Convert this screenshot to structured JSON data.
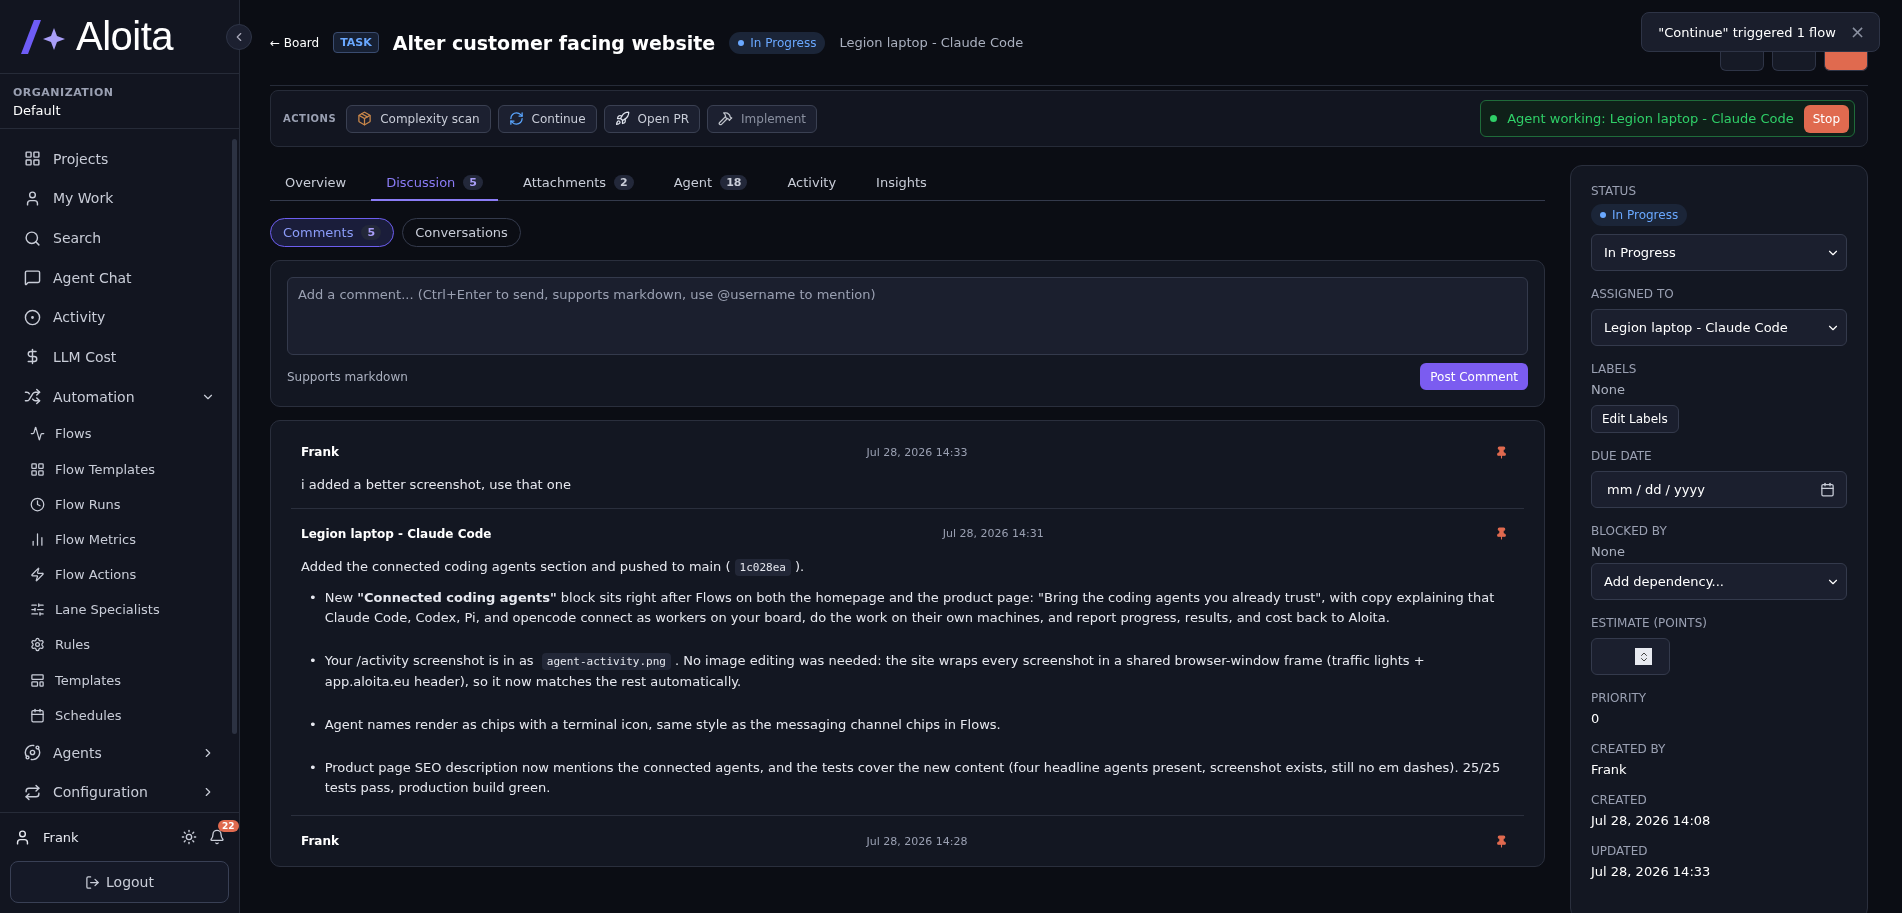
{
  "brand": {
    "name": "Aloita"
  },
  "organization": {
    "label": "ORGANIZATION",
    "name": "Default"
  },
  "sidebar": {
    "items": [
      {
        "label": "Projects",
        "selected": false
      },
      {
        "label": "My Work",
        "selected": false
      },
      {
        "label": "Search",
        "selected": false
      },
      {
        "label": "Agent Chat",
        "selected": false
      },
      {
        "label": "Activity",
        "selected": false
      },
      {
        "label": "LLM Cost",
        "selected": false
      },
      {
        "label": "Automation",
        "selected": false,
        "expanded": true,
        "children": [
          {
            "label": "Flows",
            "selected": false
          },
          {
            "label": "Flow Templates",
            "selected": false
          },
          {
            "label": "Flow Runs",
            "selected": false
          },
          {
            "label": "Flow Metrics",
            "selected": false
          },
          {
            "label": "Flow Actions",
            "selected": false
          },
          {
            "label": "Lane Specialists",
            "selected": false
          },
          {
            "label": "Rules",
            "selected": false
          },
          {
            "label": "Templates",
            "selected": false
          },
          {
            "label": "Schedules",
            "selected": false
          }
        ]
      },
      {
        "label": "Agents",
        "selected": false,
        "expanded": false
      },
      {
        "label": "Configuration",
        "selected": false,
        "expanded": false
      }
    ]
  },
  "user": {
    "name": "Frank",
    "notifications": "22",
    "logout": "Logout"
  },
  "header": {
    "back": "← Board",
    "type": "TASK",
    "title": "Alter customer facing website",
    "status": "In Progress",
    "assignee": "Legion laptop - Claude Code"
  },
  "toast": {
    "text": "\"Continue\" triggered 1 flow",
    "close": "×"
  },
  "actions": {
    "label": "ACTIONS",
    "buttons": [
      {
        "label": "Complexity scan",
        "disabled": false
      },
      {
        "label": "Continue",
        "disabled": false
      },
      {
        "label": "Open PR",
        "disabled": false
      },
      {
        "label": "Implement",
        "disabled": true
      }
    ],
    "agent_status": {
      "text": "Agent working: Legion laptop - Claude Code",
      "stop": "Stop"
    }
  },
  "tabs": [
    {
      "label": "Overview",
      "selected": false
    },
    {
      "label": "Discussion",
      "count": "5",
      "selected": true
    },
    {
      "label": "Attachments",
      "count": "2",
      "selected": false
    },
    {
      "label": "Agent",
      "count": "18",
      "selected": false
    },
    {
      "label": "Activity",
      "selected": false
    },
    {
      "label": "Insights",
      "selected": false
    }
  ],
  "subtabs": [
    {
      "label": "Comments",
      "count": "5",
      "selected": true
    },
    {
      "label": "Conversations",
      "selected": false
    }
  ],
  "composer": {
    "placeholder": "Add a comment... (Ctrl+Enter to send, supports markdown, use @username to mention)",
    "hint": "Supports markdown",
    "submit": "Post Comment"
  },
  "comments": [
    {
      "author": "Frank",
      "time": "Jul 28, 2026 14:33",
      "pinned": true,
      "body": [
        {
          "kind": "paragraph",
          "parts": [
            {
              "kind": "text",
              "text": "i added a better screenshot, use that one"
            }
          ]
        }
      ]
    },
    {
      "author": "Legion laptop - Claude Code",
      "time": "Jul 28, 2026 14:31",
      "pinned": true,
      "body": [
        {
          "kind": "paragraph",
          "parts": [
            {
              "kind": "text",
              "text": "Added the connected coding agents section and pushed to main ("
            },
            {
              "kind": "code",
              "text": "1c028ea"
            },
            {
              "kind": "text",
              "text": ")."
            }
          ]
        },
        {
          "kind": "bullet",
          "marker": "•",
          "parts": [
            {
              "kind": "text",
              "text": "New **\"Connected coding agents\"** block sits right after Flows on both the homepage and the product page: \"Bring the coding agents you already trust\", with copy explaining that Claude Code, Codex, Pi, and opencode connect as workers on your board, do the work on their own machines, and report progress, results, and cost back to Aloita."
            }
          ]
        },
        {
          "kind": "bullet",
          "marker": "•",
          "parts": [
            {
              "kind": "text",
              "text": "Your /activity screenshot is in as "
            },
            {
              "kind": "code",
              "text": "agent-activity.png"
            },
            {
              "kind": "text",
              "text": ". No image editing was needed: the site wraps every screenshot in a shared browser-window frame (traffic lights + app.aloita.eu header), so it now matches the rest automatically."
            }
          ]
        },
        {
          "kind": "bullet",
          "marker": "•",
          "parts": [
            {
              "kind": "text",
              "text": "Agent names render as chips with a terminal icon, same style as the messaging channel chips in Flows."
            }
          ]
        },
        {
          "kind": "bullet",
          "marker": "•",
          "parts": [
            {
              "kind": "text",
              "text": "Product page SEO description now mentions the connected agents, and the tests cover the new content (four headline agents present, screenshot exists, still no em dashes). 25/25 tests pass, production build green."
            }
          ]
        }
      ]
    },
    {
      "author": "Frank",
      "time": "Jul 28, 2026 14:28",
      "pinned": true
    }
  ],
  "details": {
    "status": {
      "label": "STATUS",
      "badge": "In Progress",
      "value": "In Progress"
    },
    "assigned": {
      "label": "ASSIGNED TO",
      "value": "Legion laptop - Claude Code"
    },
    "labels": {
      "label": "LABELS",
      "value": "None",
      "button": "Edit Labels"
    },
    "due": {
      "label": "DUE DATE",
      "placeholder": "mm / dd / yyyy"
    },
    "blocked": {
      "label": "BLOCKED BY",
      "value": "None",
      "select": "Add dependency..."
    },
    "estimate": {
      "label": "ESTIMATE (POINTS)"
    },
    "facts": [
      {
        "label": "PRIORITY",
        "value": "0"
      },
      {
        "label": "CREATED BY",
        "value": "Frank"
      },
      {
        "label": "CREATED",
        "value": "Jul 28, 2026 14:08"
      },
      {
        "label": "UPDATED",
        "value": "Jul 28, 2026 14:33"
      }
    ]
  }
}
